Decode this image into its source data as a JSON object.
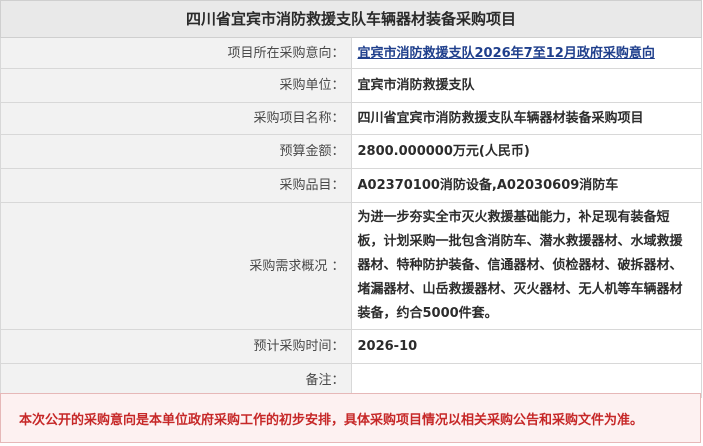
{
  "title": "四川省宜宾市消防救援支队车辆器材装备采购项目",
  "rows": [
    {
      "label": "项目所在采购意向：",
      "value": "宜宾市消防救援支队2026年7至12月政府采购意向"
    },
    {
      "label": "采购单位：",
      "value": "宜宾市消防救援支队"
    },
    {
      "label": "采购项目名称：",
      "value": "四川省宜宾市消防救援支队车辆器材装备采购项目"
    },
    {
      "label": "预算金额：",
      "value": "2800.000000万元(人民币)"
    },
    {
      "label": "采购品目：",
      "value": "A02370100消防设备,A02030609消防车"
    },
    {
      "label": "采购需求概况 ：",
      "value": "为进一步夯实全市灭火救援基础能力，补足现有装备短板，计划采购一批包含消防车、潜水救援器材、水域救援器材、特种防护装备、信通器材、侦检器材、破拆器材、堵漏器材、山岳救援器材、灭火器材、无人机等车辆器材装备，约合5000件套。"
    },
    {
      "label": "预计采购时间：",
      "value": "2026-10"
    },
    {
      "label": "备注：",
      "value": ""
    }
  ],
  "notice": "本次公开的采购意向是本单位政府采购工作的初步安排，具体采购项目情况以相关采购公告和采购文件为准。",
  "colors": {
    "link": "#1f3f8c",
    "notice_text": "#c62828",
    "notice_bg": "#fdf1f1",
    "label_bg": "#f2f2f2",
    "title_bg": "#e9e9e9"
  }
}
